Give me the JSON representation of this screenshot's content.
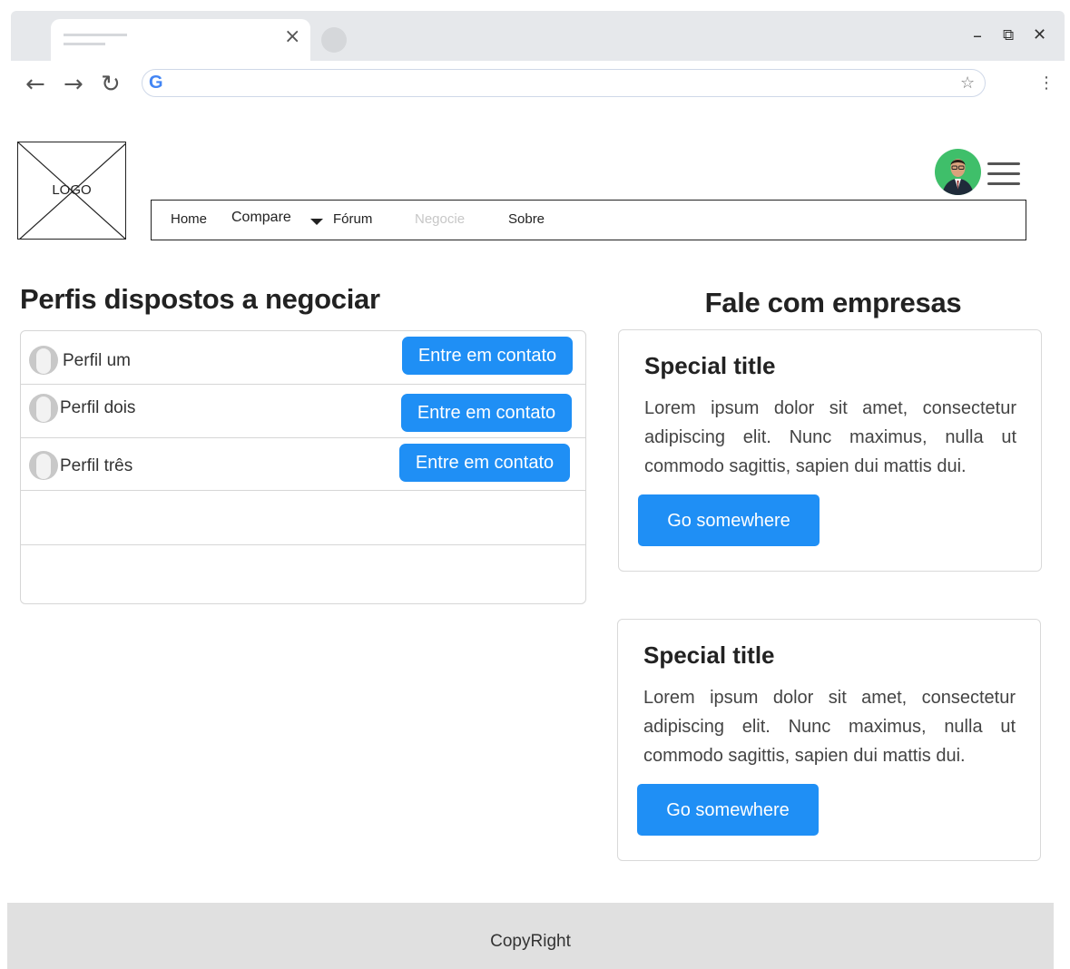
{
  "browser": {
    "tab_close_glyph": "×",
    "window_controls": {
      "minimize": "–",
      "restore": "⧉",
      "close": "✕"
    },
    "nav": {
      "back": "←",
      "forward": "→",
      "reload": "↻"
    },
    "search_engine_glyph": "G",
    "address_value": "",
    "bookmark_glyph": "☆",
    "menu_glyph": "⋮"
  },
  "header": {
    "logo_text": "LOGO",
    "nav_items": [
      {
        "label": "Home",
        "disabled": false
      },
      {
        "label": "Compare",
        "disabled": false,
        "has_dropdown": true
      },
      {
        "label": "Fórum",
        "disabled": false
      },
      {
        "label": "Negocie",
        "disabled": true
      },
      {
        "label": "Sobre",
        "disabled": false
      }
    ]
  },
  "left": {
    "heading": "Perfis dispostos a negociar",
    "profiles": [
      {
        "name": "Perfil um",
        "action": "Entre em contato"
      },
      {
        "name": "Perfil dois",
        "action": "Entre em contato"
      },
      {
        "name": "Perfil três",
        "action": "Entre em contato"
      }
    ]
  },
  "right": {
    "heading": "Fale com empresas",
    "cards": [
      {
        "title": "Special title",
        "text": "Lorem ipsum dolor sit amet, consectetur adipiscing elit. Nunc maximus, nulla ut commodo sagittis, sapien dui mattis dui.",
        "button": "Go somewhere"
      },
      {
        "title": "Special title",
        "text": "Lorem ipsum dolor sit amet, consectetur adipiscing elit. Nunc maximus, nulla ut commodo sagittis, sapien dui mattis dui.",
        "button": "Go somewhere"
      }
    ]
  },
  "footer": {
    "text": "CopyRight"
  },
  "colors": {
    "accent": "#1f8ff5",
    "disabled_text": "#c7c7c7",
    "avatar_bg": "#3fbf6a",
    "footer_bg": "#e0e0e0"
  }
}
